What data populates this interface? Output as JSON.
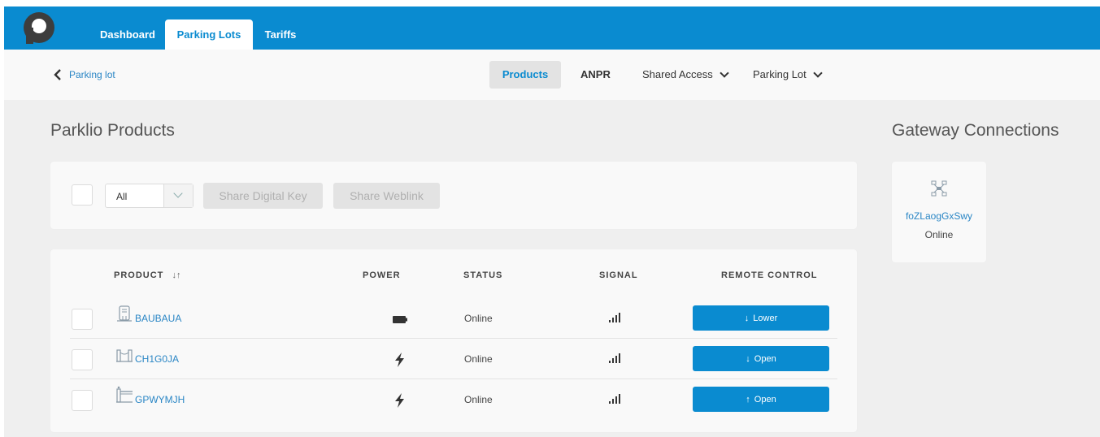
{
  "nav": {
    "tabs": [
      {
        "label": "Dashboard",
        "active": false
      },
      {
        "label": "Parking Lots",
        "active": true
      },
      {
        "label": "Tariffs",
        "active": false
      }
    ]
  },
  "subnav": {
    "back_label": "Parking lot",
    "tabs": [
      {
        "label": "Products",
        "active": true
      },
      {
        "label": "ANPR"
      },
      {
        "label": "Shared Access",
        "has_dropdown": true
      },
      {
        "label": "Parking Lot",
        "has_dropdown": true
      }
    ]
  },
  "products": {
    "title": "Parklio Products",
    "filter": {
      "selected": "All",
      "share_digital_key": "Share Digital Key",
      "share_weblink": "Share Weblink"
    },
    "columns": [
      "PRODUCT",
      "POWER",
      "STATUS",
      "SIGNAL",
      "REMOTE CONTROL"
    ],
    "rows": [
      {
        "name": "BAUBAUA",
        "product_icon": "barrier-icon",
        "power_icon": "battery-icon",
        "status": "Online",
        "signal_icon": "signal-bars-icon",
        "remote_label": "Lower",
        "remote_icon": "arrow-down-icon"
      },
      {
        "name": "CH1G0JA",
        "product_icon": "chain-icon",
        "power_icon": "lightning-icon",
        "status": "Online",
        "signal_icon": "signal-bars-icon",
        "remote_label": "Open",
        "remote_icon": "arrow-down-icon"
      },
      {
        "name": "GPWYMJH",
        "product_icon": "boom-gate-icon",
        "power_icon": "lightning-icon",
        "status": "Online",
        "signal_icon": "signal-bars-icon",
        "remote_label": "Open",
        "remote_icon": "arrow-up-icon"
      }
    ]
  },
  "gateway": {
    "title": "Gateway Connections",
    "name": "foZLaogGxSwy",
    "status": "Online"
  },
  "colors": {
    "primary": "#0a8bd0",
    "link": "#2a86c5",
    "background": "#efefef"
  }
}
